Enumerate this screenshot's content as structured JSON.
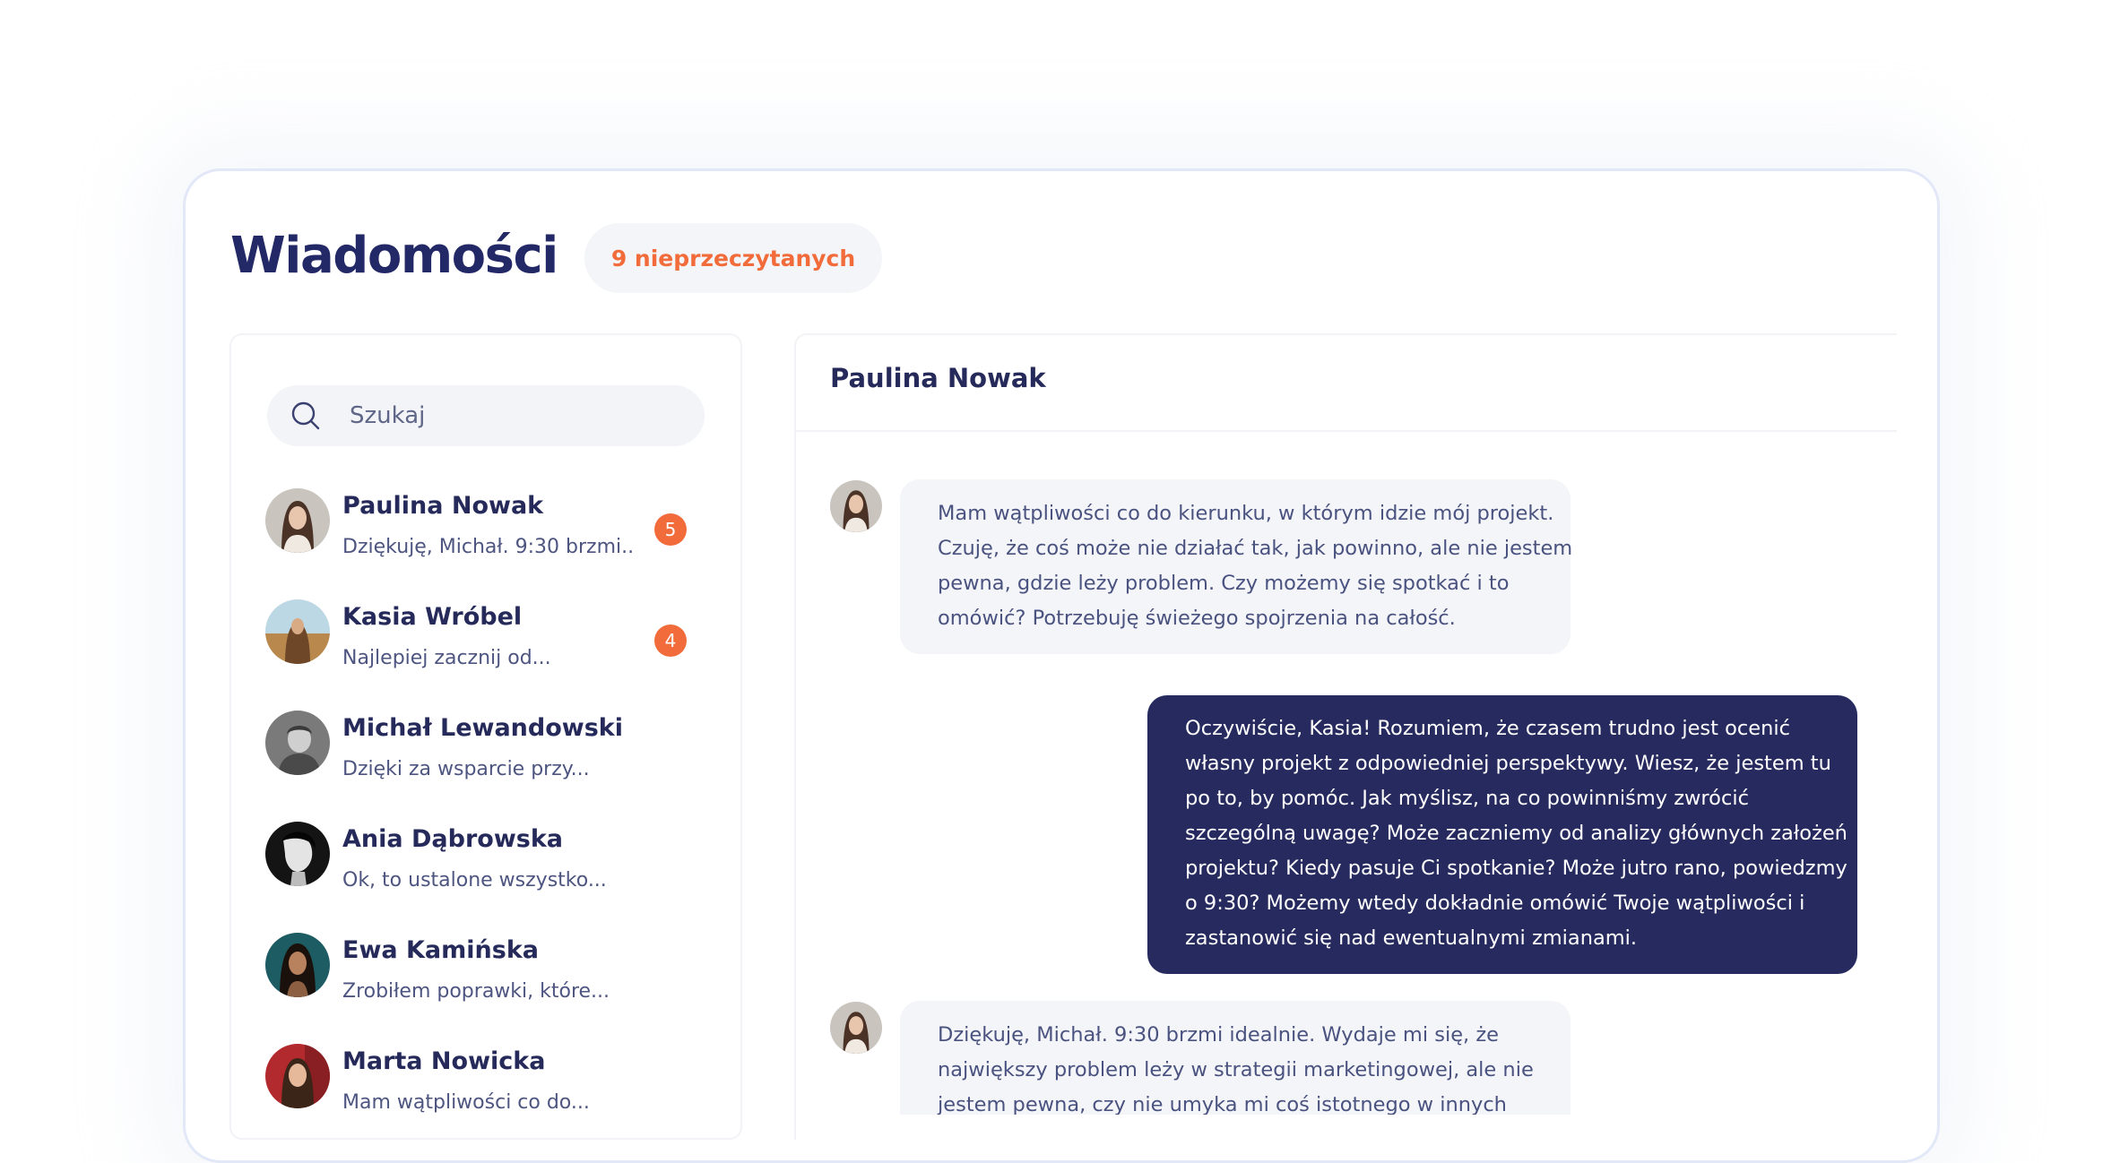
{
  "header": {
    "title": "Wiadomości",
    "unread_label": "9 nieprzeczytanych"
  },
  "search": {
    "placeholder": "Szukaj",
    "icon": "search-icon"
  },
  "contacts": [
    {
      "name": "Paulina Nowak",
      "preview": "Dziękuję, Michał. 9:30 brzmi..",
      "unread": "5"
    },
    {
      "name": "Kasia Wróbel",
      "preview": "Najlepiej zacznij od...",
      "unread": "4"
    },
    {
      "name": "Michał Lewandowski",
      "preview": "Dzięki za wsparcie przy..."
    },
    {
      "name": "Ania Dąbrowska",
      "preview": "Ok, to ustalone wszystko..."
    },
    {
      "name": "Ewa Kamińska",
      "preview": "Zrobiłem poprawki, które..."
    },
    {
      "name": "Marta Nowicka",
      "preview": "Mam wątpliwości co do..."
    }
  ],
  "chat": {
    "title": "Paulina Nowak",
    "messages": [
      {
        "direction": "incoming",
        "lines": [
          "Mam wątpliwości co do kierunku, w którym idzie mój projekt.",
          "Czuję, że coś może nie działać tak, jak powinno, ale nie jestem",
          "pewna, gdzie leży problem. Czy możemy się spotkać i to",
          "omówić? Potrzebuję świeżego spojrzenia na całość."
        ]
      },
      {
        "direction": "outgoing",
        "lines": [
          "Oczywiście, Kasia! Rozumiem, że czasem trudno jest ocenić",
          "własny projekt z odpowiedniej perspektywy. Wiesz, że jestem tu",
          "po to, by pomóc. Jak myślisz, na co powinniśmy zwrócić",
          "szczególną uwagę? Może zaczniemy od analizy głównych założeń",
          "projektu? Kiedy pasuje Ci spotkanie? Może jutro rano, powiedzmy",
          "o 9:30? Możemy wtedy dokładnie omówić Twoje wątpliwości i",
          "zastanowić się nad ewentualnymi zmianami."
        ]
      },
      {
        "direction": "incoming",
        "lines": [
          "Dziękuję, Michał. 9:30 brzmi idealnie. Wydaje mi się, że",
          "największy problem leży w strategii marketingowej, ale nie",
          "jestem pewna, czy nie umyka mi coś istotnego w innych"
        ]
      }
    ]
  },
  "colors": {
    "accent": "#f26b3a",
    "navy": "#262a5e",
    "bubble_incoming": "#f4f5f8"
  }
}
